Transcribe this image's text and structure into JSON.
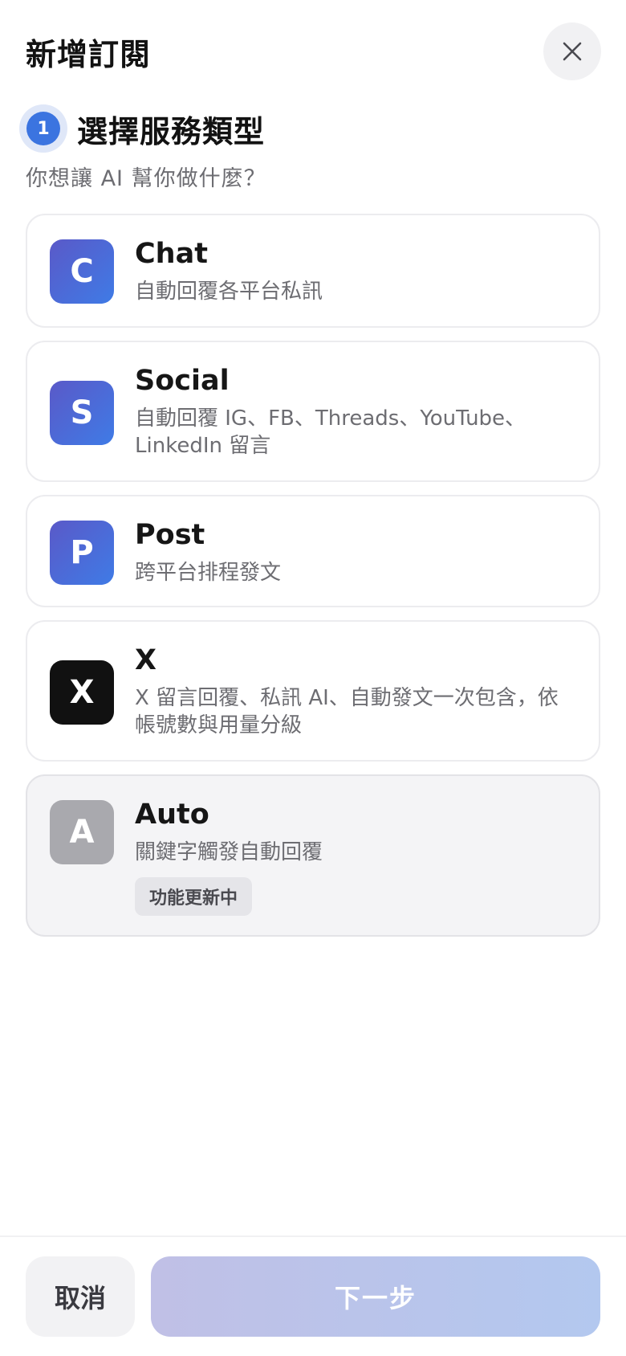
{
  "header": {
    "title": "新增訂閱",
    "close_icon": "close-icon"
  },
  "step": {
    "number": "1",
    "title": "選擇服務類型",
    "subtitle": "你想讓 AI 幫你做什麼？"
  },
  "services": [
    {
      "letter": "C",
      "name": "Chat",
      "description": "自動回覆各平台私訊",
      "color": "#4f6bdc"
    },
    {
      "letter": "S",
      "name": "Social",
      "description": "自動回覆 IG、FB、Threads、YouTube、LinkedIn 留言",
      "color": "#4f6bdc"
    },
    {
      "letter": "P",
      "name": "Post",
      "description": "跨平台排程發文",
      "color": "#4f6bdc"
    },
    {
      "letter": "X",
      "name": "X",
      "description": "X 留言回覆、私訊 AI、自動發文一次包含，依帳號數與用量分級",
      "color": "#111111"
    },
    {
      "letter": "A",
      "name": "Auto",
      "description": "關鍵字觸發自動回覆",
      "tag": "功能更新中",
      "color": "#a9a9ae"
    }
  ],
  "footer": {
    "cancel_label": "取消",
    "next_label": "下一步"
  }
}
